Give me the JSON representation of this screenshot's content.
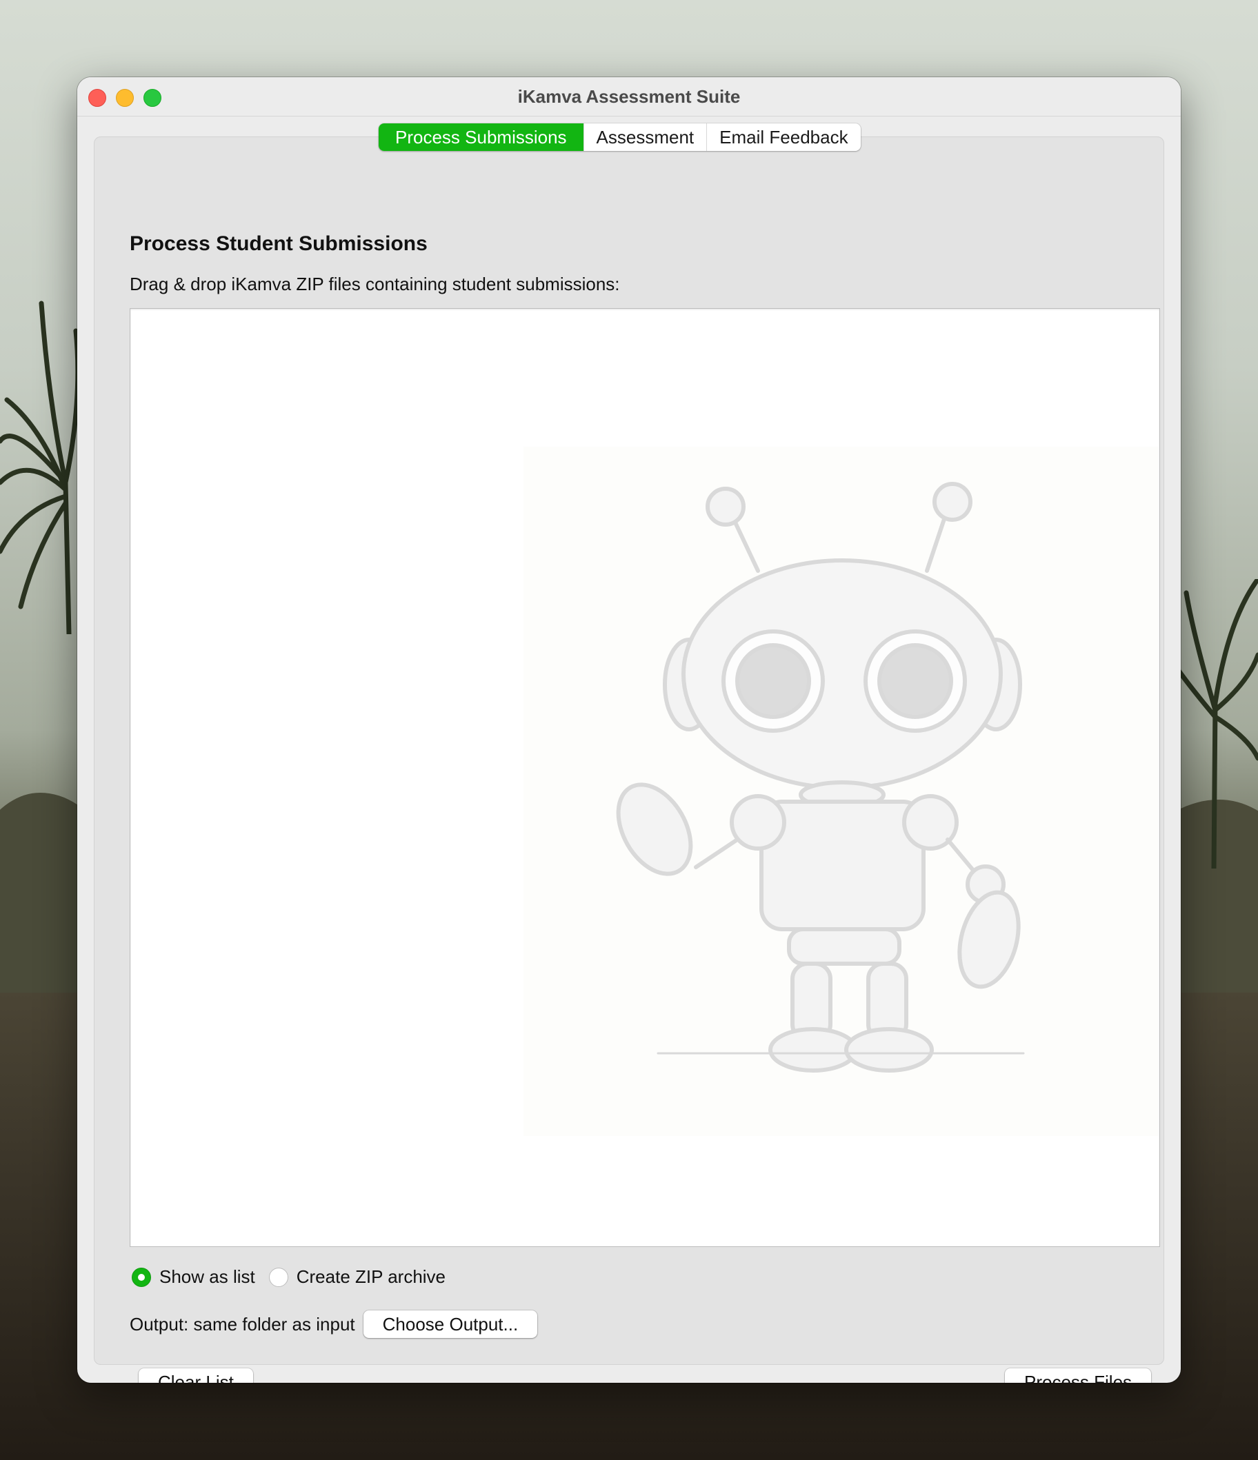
{
  "window": {
    "title": "iKamva Assessment Suite",
    "accent_color": "#12b512"
  },
  "tabs": [
    {
      "label": "Process Submissions",
      "active": true
    },
    {
      "label": "Assessment",
      "active": false
    },
    {
      "label": "Email Feedback",
      "active": false
    }
  ],
  "panel": {
    "heading": "Process Student Submissions",
    "instruction": "Drag & drop iKamva ZIP files containing student submissions:",
    "dropzone_illustration": "robot-sketch"
  },
  "options": {
    "radios": [
      {
        "label": "Show as list",
        "checked": true
      },
      {
        "label": "Create ZIP archive",
        "checked": false
      }
    ]
  },
  "output": {
    "label": "Output: same folder as input",
    "choose_button": "Choose Output..."
  },
  "actions": {
    "clear_button": "Clear List",
    "process_button": "Process Files"
  }
}
